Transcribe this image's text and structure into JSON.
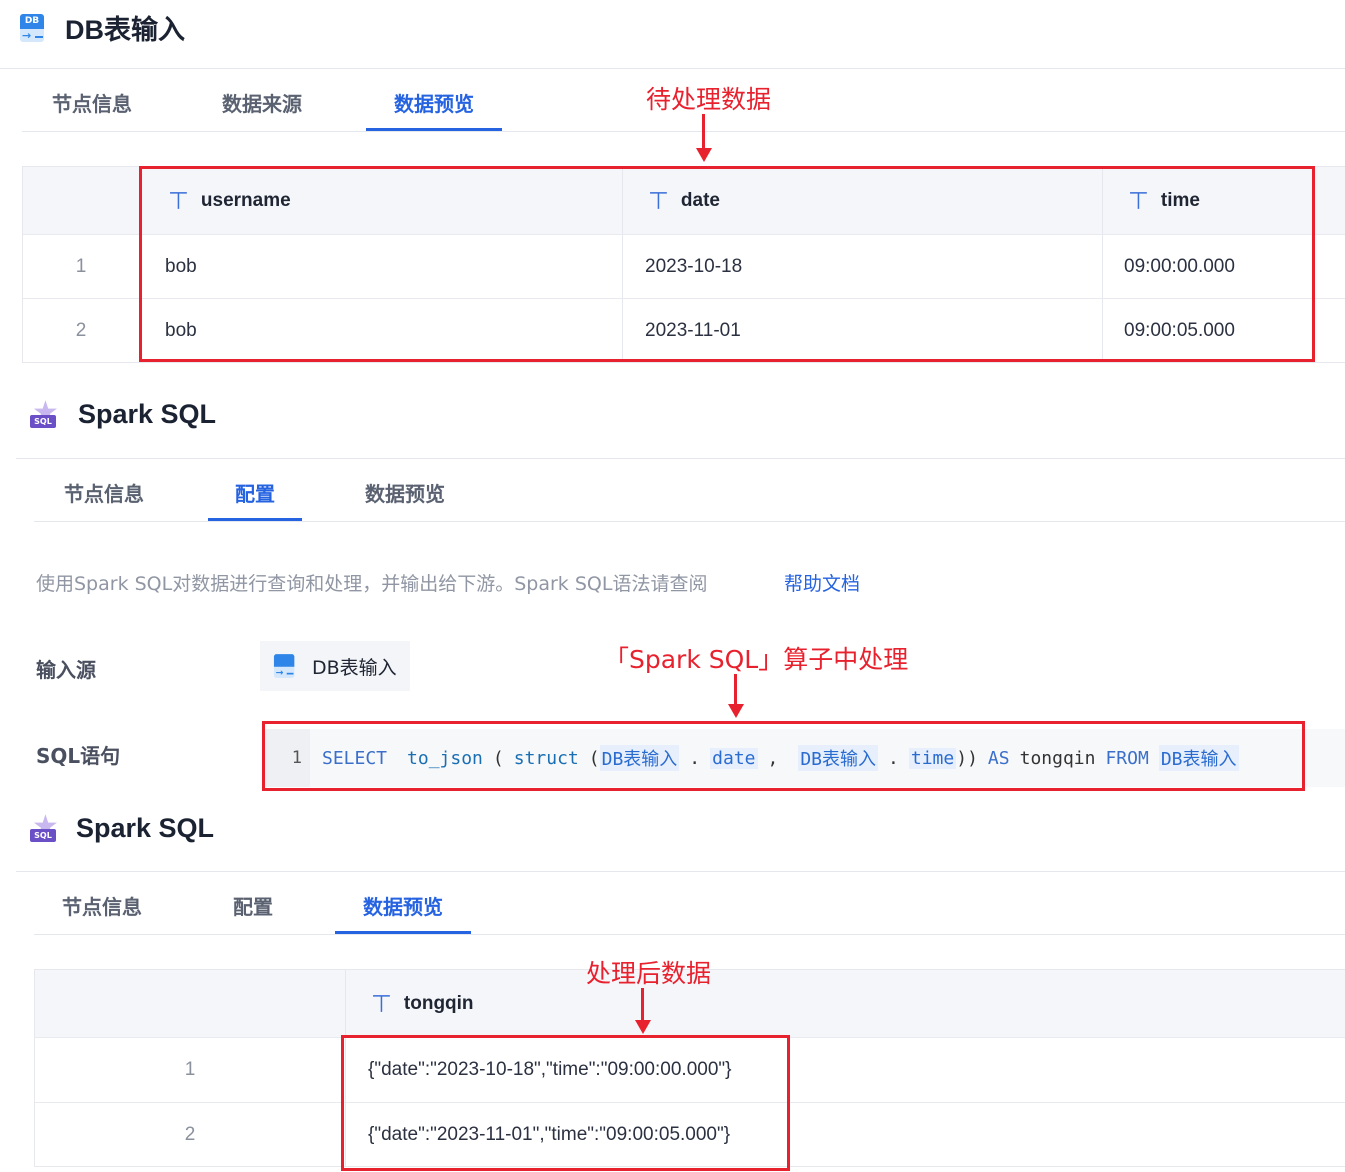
{
  "db_node": {
    "title": "DB表输入",
    "icon_text": "DB",
    "tabs": [
      {
        "label": "节点信息",
        "active": false
      },
      {
        "label": "数据来源",
        "active": false
      },
      {
        "label": "数据预览",
        "active": true
      }
    ],
    "table": {
      "columns": [
        "username",
        "date",
        "time"
      ],
      "rows": [
        {
          "index": "1",
          "cells": [
            "bob",
            "2023-10-18",
            "09:00:00.000"
          ]
        },
        {
          "index": "2",
          "cells": [
            "bob",
            "2023-11-01",
            "09:00:05.000"
          ]
        }
      ]
    }
  },
  "sql_node_config": {
    "title": "Spark SQL",
    "icon_text": "SQL",
    "tabs": [
      {
        "label": "节点信息",
        "active": false
      },
      {
        "label": "配置",
        "active": true
      },
      {
        "label": "数据预览",
        "active": false
      }
    ],
    "description": "使用Spark SQL对数据进行查询和处理，并输出给下游。Spark SQL语法请查阅",
    "help_link": "帮助文档",
    "input_source_label": "输入源",
    "input_source_value": "DB表输入",
    "sql_label": "SQL语句",
    "code": {
      "line_number": "1",
      "tokens": {
        "select": "SELECT",
        "to_json": "to_json",
        "lparen1": "(",
        "struct": "struct",
        "lparen2": "(",
        "ref1": "DB表输入",
        "dot1": ".",
        "col1": "date",
        "comma": ",",
        "ref2": "DB表输入",
        "dot2": ".",
        "col2": "time",
        "rparen": "))",
        "as": "AS",
        "alias": "tongqin",
        "from": "FROM",
        "ref3": "DB表输入"
      }
    }
  },
  "sql_node_preview": {
    "title": "Spark SQL",
    "icon_text": "SQL",
    "tabs": [
      {
        "label": "节点信息",
        "active": false
      },
      {
        "label": "配置",
        "active": false
      },
      {
        "label": "数据预览",
        "active": true
      }
    ],
    "table": {
      "columns": [
        "tongqin"
      ],
      "rows": [
        {
          "index": "1",
          "cells": [
            "{\"date\":\"2023-10-18\",\"time\":\"09:00:00.000\"}"
          ]
        },
        {
          "index": "2",
          "cells": [
            "{\"date\":\"2023-11-01\",\"time\":\"09:00:05.000\"}"
          ]
        }
      ]
    }
  },
  "annotations": {
    "pending_data": "待处理数据",
    "processing": "「Spark SQL」算子中处理",
    "processed_data": "处理后数据",
    "color": "#e8212e"
  },
  "colors": {
    "accent": "#2663e0",
    "header_bg": "#f5f6f9"
  }
}
